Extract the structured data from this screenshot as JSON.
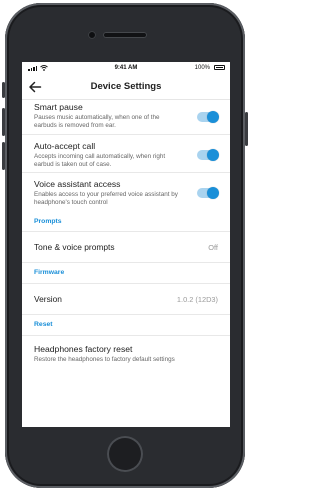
{
  "status_bar": {
    "time": "9:41 AM",
    "battery": "100%"
  },
  "header": {
    "title": "Device Settings"
  },
  "settings": {
    "smart_pause": {
      "title": "Smart pause",
      "desc": "Pauses music automatically, when one of the earbuds is removed from ear.",
      "enabled": true
    },
    "auto_accept": {
      "title": "Auto-accept call",
      "desc": "Accepts incoming call automatically, when right earbud is taken out of case.",
      "enabled": true
    },
    "voice_assistant": {
      "title": "Voice assistant access",
      "desc": "Enables access to your preferred voice assistant by headphone's touch control",
      "enabled": true
    }
  },
  "sections": {
    "prompts": "Prompts",
    "firmware": "Firmware",
    "reset": "Reset"
  },
  "prompts": {
    "label": "Tone & voice prompts",
    "value": "Off"
  },
  "firmware": {
    "label": "Version",
    "value": "1.0.2 (12D3)"
  },
  "reset": {
    "title": "Headphones factory reset",
    "desc": "Restore the headphones to factory default settings"
  },
  "colors": {
    "accent": "#1a8fd8",
    "toggle_track": "#a9d3ef"
  }
}
